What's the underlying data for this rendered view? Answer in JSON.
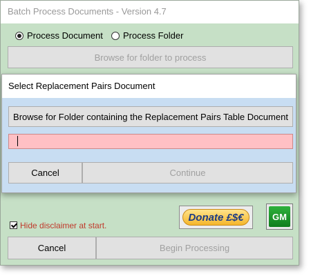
{
  "window": {
    "title": "Batch Process Documents - Version 4.7",
    "mode_options": [
      {
        "label": "Process Document",
        "selected": true
      },
      {
        "label": "Process Folder",
        "selected": false
      }
    ],
    "browse_folder_button": "Browse for folder to process"
  },
  "dialog": {
    "title": "Select Replacement Pairs Document",
    "browse_button": "Browse for Folder containing the Replacement Pairs Table Document",
    "path_value": "",
    "cancel_label": "Cancel",
    "continue_label": "Continue"
  },
  "footer": {
    "donate_label": "Donate £$€",
    "gm_label": "GM",
    "disclaimer_label": "Hide disclaimer at start.",
    "disclaimer_checked": true,
    "cancel_label": "Cancel",
    "begin_label": "Begin Processing"
  },
  "colors": {
    "window_bg": "#c6e0c6",
    "dialog_bg": "#c8ddf2",
    "input_bg": "#ffc0c4",
    "disclaimer_text": "#c0392b"
  }
}
